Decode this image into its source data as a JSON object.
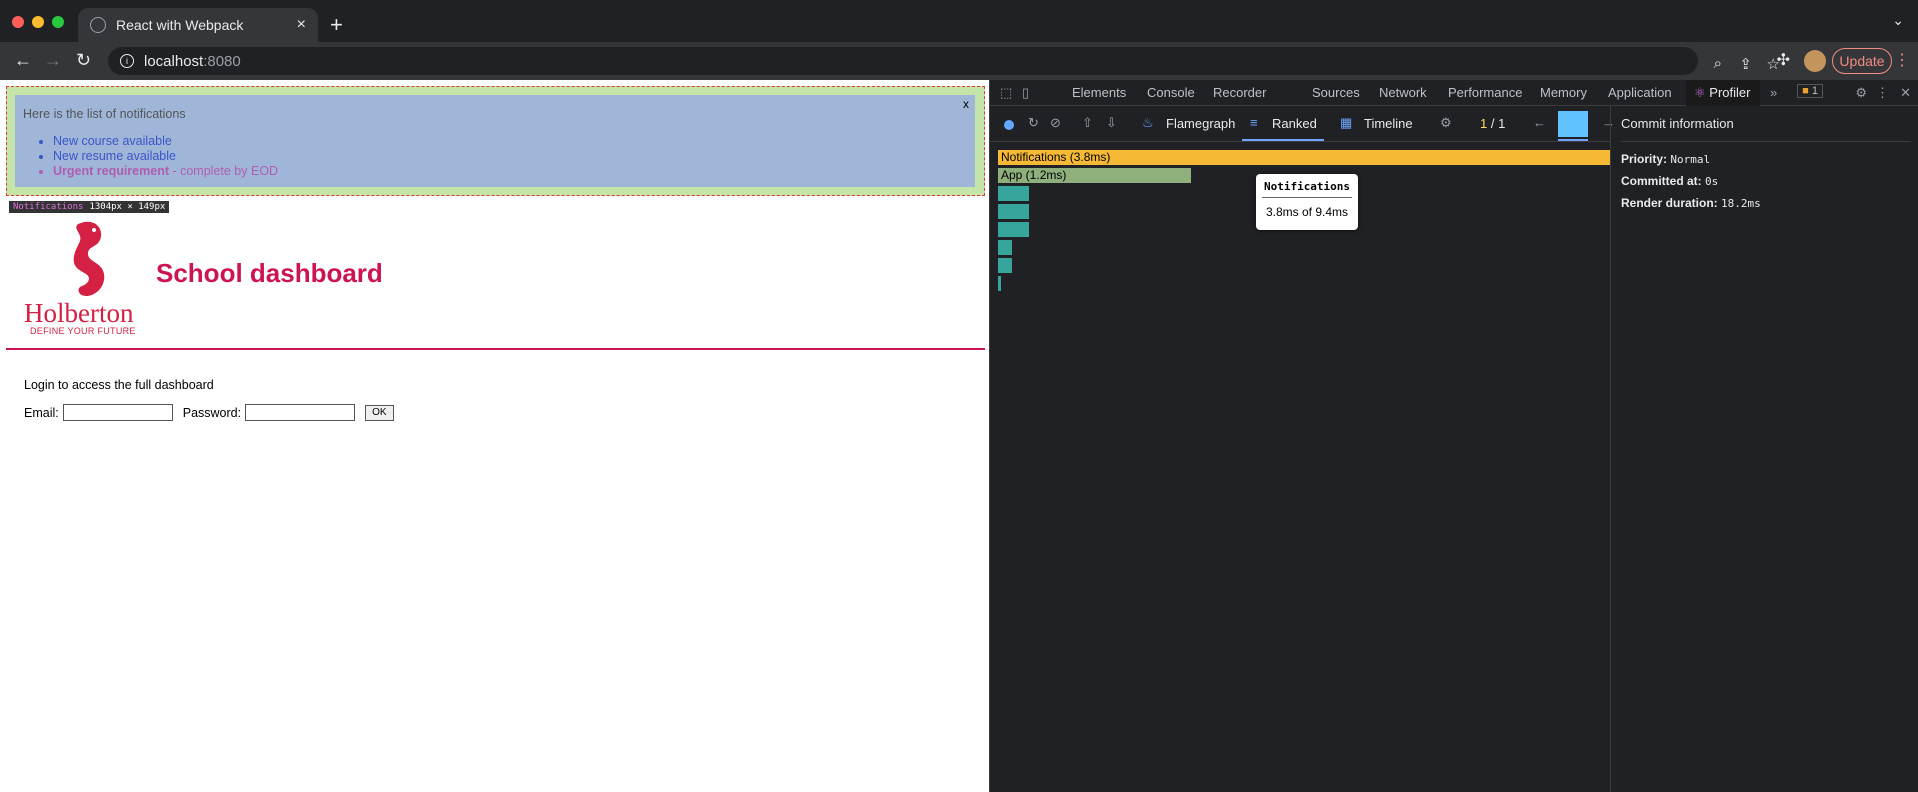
{
  "browser": {
    "tab_title": "React with Webpack",
    "new_tab": "+",
    "tab_close": "×",
    "url_host": "localhost",
    "url_port": ":8080",
    "update_label": "Update"
  },
  "page": {
    "notifications_intro": "Here is the list of notifications",
    "notifications": [
      {
        "text": "New course available",
        "type": "default"
      },
      {
        "text": "New resume available",
        "type": "default"
      },
      {
        "text": "Urgent requirement",
        "suffix": " - complete by EOD",
        "type": "urgent"
      }
    ],
    "close_label": "x",
    "inspect_name": "Notifications",
    "inspect_size": "1304px × 149px",
    "logo_text": "Holberton",
    "logo_subtext": "DEFINE YOUR FUTURE",
    "title": "School dashboard",
    "login_text": "Login to access the full dashboard",
    "email_label": "Email:",
    "password_label": "Password:",
    "ok_label": "OK"
  },
  "devtools": {
    "tabs": [
      "Elements",
      "Console",
      "Recorder",
      "Sources",
      "Network",
      "Performance",
      "Memory",
      "Application",
      "Profiler"
    ],
    "active_tab": "Profiler",
    "issues_count": "1",
    "profiler": {
      "modes": [
        "Flamegraph",
        "Ranked",
        "Timeline"
      ],
      "active_mode": "Ranked",
      "commit_current": "1",
      "commit_total": "1"
    },
    "ranked_bars": [
      {
        "label": "Notifications (3.8ms)",
        "value": 3.8,
        "color": "#f5b935"
      },
      {
        "label": "App (1.2ms)",
        "value": 1.2,
        "color": "#8fb07c"
      },
      {
        "label": "",
        "value": 0.19,
        "color": "#37a59b"
      },
      {
        "label": "",
        "value": 0.19,
        "color": "#37a59b"
      },
      {
        "label": "",
        "value": 0.19,
        "color": "#37a59b"
      },
      {
        "label": "",
        "value": 0.09,
        "color": "#37a59b"
      },
      {
        "label": "",
        "value": 0.09,
        "color": "#37a59b"
      },
      {
        "label": "",
        "value": 0.02,
        "color": "#37a59b"
      }
    ],
    "tooltip": {
      "title": "Notifications",
      "body": "3.8ms of 9.4ms"
    },
    "commit_info": {
      "header": "Commit information",
      "priority_label": "Priority:",
      "priority_value": "Normal",
      "committed_label": "Committed at:",
      "committed_value": "0s",
      "render_label": "Render duration:",
      "render_value": "18.2ms"
    }
  }
}
